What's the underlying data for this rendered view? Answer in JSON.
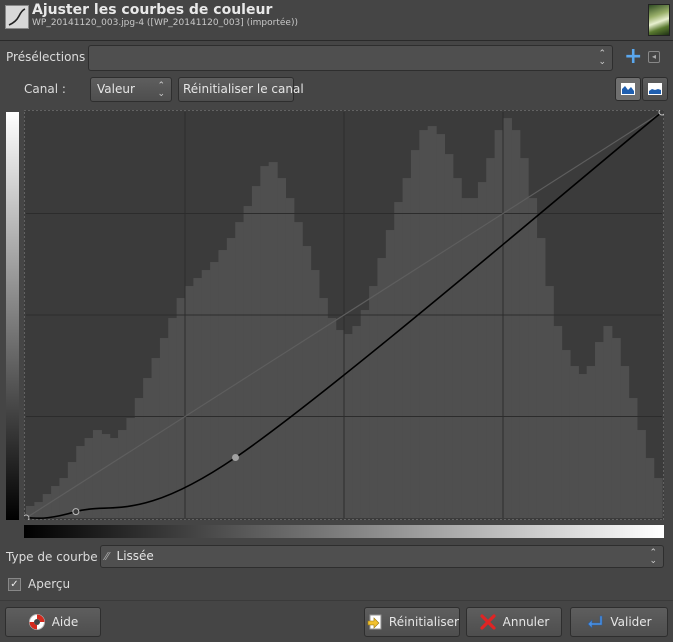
{
  "header": {
    "title": "Ajuster les courbes de couleur",
    "subtitle": "WP_20141120_003.jpg-4 ([WP_20141120_003] (importée))"
  },
  "presets": {
    "label": "Présélections :",
    "value": ""
  },
  "channel": {
    "label": "Canal :",
    "value": "Valeur",
    "reset_label": "Réinitialiser le canal"
  },
  "curve_type": {
    "label": "Type de courbe :",
    "value": "Lissée",
    "icon": "smooth-curve-icon"
  },
  "preview": {
    "label": "Aperçu",
    "checked": true
  },
  "buttons": {
    "help": "Aide",
    "reset": "Réinitialiser",
    "cancel": "Annuler",
    "ok": "Valider"
  },
  "curve": {
    "points": [
      [
        0,
        0
      ],
      [
        20,
        4
      ],
      [
        84,
        38
      ],
      [
        255,
        255
      ]
    ]
  },
  "histogram": [
    3,
    4,
    6,
    8,
    10,
    14,
    18,
    20,
    22,
    21,
    20,
    22,
    25,
    30,
    35,
    40,
    45,
    50,
    55,
    58,
    60,
    62,
    64,
    67,
    70,
    74,
    78,
    83,
    88,
    89,
    85,
    80,
    74,
    68,
    62,
    55,
    50,
    47,
    46,
    48,
    52,
    58,
    65,
    72,
    79,
    85,
    92,
    97,
    98,
    96,
    91,
    85,
    80,
    80,
    84,
    90,
    97,
    100,
    97,
    90,
    80,
    70,
    58,
    48,
    42,
    38,
    36,
    38,
    44,
    48,
    45,
    38,
    30,
    22,
    15,
    10
  ]
}
